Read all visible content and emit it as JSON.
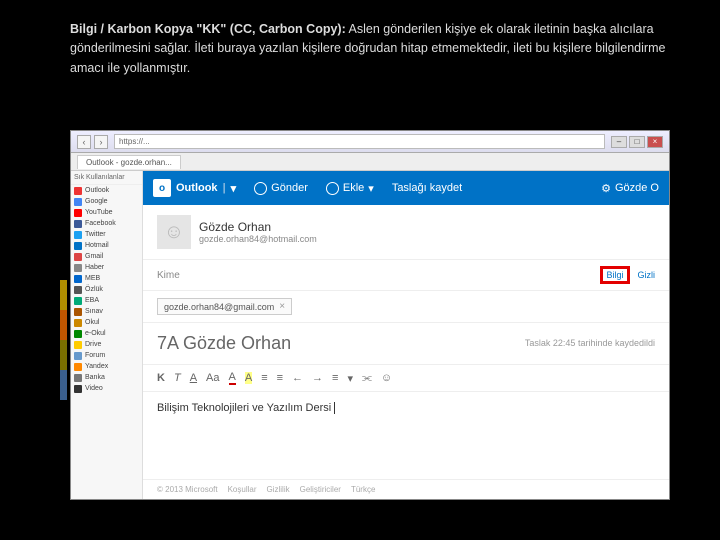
{
  "header": {
    "bold": "Bilgi / Karbon Kopya \"KK\" (CC, Carbon Copy):",
    "rest": " Aslen gönderilen kişiye ek olarak iletinin başka alıcılara gönderilmesini sağlar. İleti buraya yazılan kişilere doğrudan hitap etmemektedir, ileti bu kişilere bilgilendirme amacı ile yollanmıştır."
  },
  "browser": {
    "url": "https://...",
    "tab": "Outlook - gozde.orhan...",
    "side_label": "Sık Kullanılanlar"
  },
  "bookmarks": [
    "Outlook",
    "Google",
    "YouTube",
    "Facebook",
    "Twitter",
    "Hotmail",
    "Gmail",
    "Haber",
    "MEB",
    "Özlük",
    "EBA",
    "Sınav",
    "Okul",
    "e-Okul",
    "Drive",
    "Forum",
    "Yandex",
    "Banka",
    "Video"
  ],
  "toolbar": {
    "brand": "Outlook",
    "brand_logo": "o",
    "dd": "▾",
    "send": "Gönder",
    "attach": "Ekle",
    "savedraft": "Taslağı kaydet",
    "user": "Gözde O"
  },
  "sender": {
    "name": "Gözde Orhan",
    "email": "gozde.orhan84@hotmail.com",
    "avatar": "☺"
  },
  "to": {
    "label": "Kime",
    "bcc": "Bilgi",
    "hide": "Gizli"
  },
  "cc": {
    "chip": "gozde.orhan84@gmail.com",
    "x": "×"
  },
  "subject": {
    "text": "7A Gözde Orhan",
    "draft": "Taslak 22:45 tarihinde\nkaydedildi"
  },
  "fmt": {
    "b": "K",
    "i": "T",
    "u": "A",
    "s": "Aa",
    "fcol": "A",
    "bcol": "A",
    "ul": "≡",
    "ol": "≡",
    "oi": "←",
    "oo": "→",
    "al": "≡",
    "more": "▾",
    "link": "⫘",
    "emoji": "☺"
  },
  "body": "Bilişim Teknolojileri ve Yazılım Dersi",
  "footer": {
    "cp": "© 2013 Microsoft",
    "terms": "Koşullar",
    "priv": "Gizlilik",
    "dev": "Geliştiriciler",
    "lang": "Türkçe"
  },
  "accents": [
    "#b08f00",
    "#c05500",
    "#7a6f00",
    "#3a5f8f"
  ]
}
